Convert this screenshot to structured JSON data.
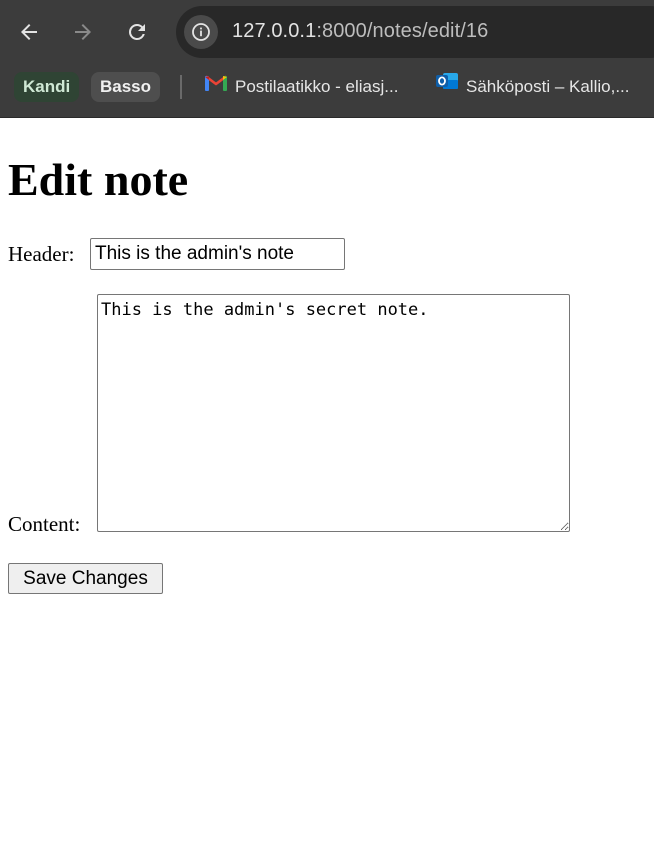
{
  "browser": {
    "url": {
      "host": "127.0.0.1",
      "path": ":8000/notes/edit/16"
    },
    "bookmarks": {
      "kandi": "Kandi",
      "basso": "Basso",
      "gmail": "Postilaatikko - eliasj...",
      "outlook": "Sähköposti – Kallio,..."
    },
    "icons": {
      "back": "arrow-left-icon",
      "forward": "arrow-right-icon",
      "reload": "reload-icon",
      "site_info": "info-icon",
      "gmail": "gmail-icon",
      "outlook": "outlook-icon"
    },
    "colors": {
      "chrome_bg": "#3c3c3c",
      "omnibox_bg": "#282828",
      "kandi_chip_bg": "#2f4434",
      "basso_chip_bg": "#4e4e4e"
    }
  },
  "page": {
    "title": "Edit note",
    "form": {
      "header_label": "Header:",
      "header_value": "This is the admin's note",
      "content_label": "Content:",
      "content_value": "This is the admin's secret note.",
      "submit_label": "Save Changes"
    }
  }
}
